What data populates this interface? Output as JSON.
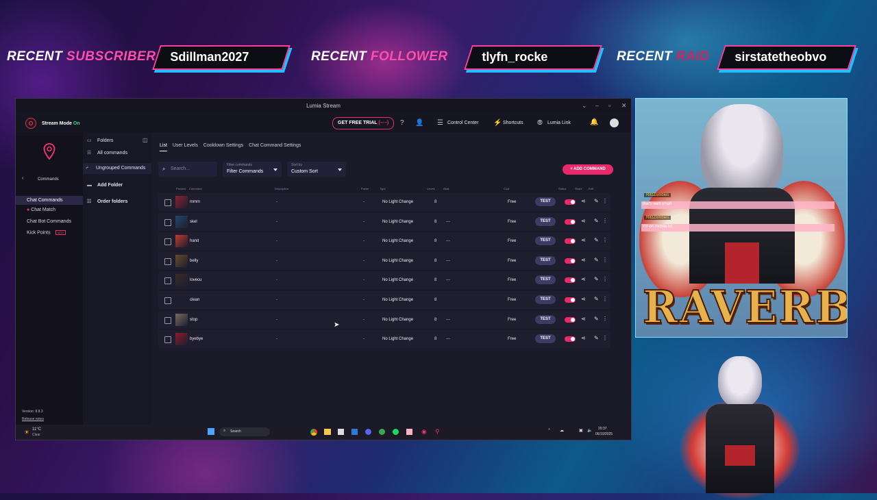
{
  "banners": {
    "subscriber": {
      "label_a": "RECENT ",
      "label_b": "SUBSCRIBER",
      "name": "Sdillman2027"
    },
    "follower": {
      "label_a": "RECENT ",
      "label_b": "FOLLOWER",
      "name": "tlyfn_rocke"
    },
    "raid": {
      "label_a": "RECENT ",
      "label_b": "RAID",
      "name": "sirstatetheobvo"
    }
  },
  "window": {
    "title": "Lumia Stream",
    "stream_mode": "Stream Mode",
    "stream_mode_state": "On",
    "free_trial": "GET FREE TRIAL",
    "control_center": "Control Center",
    "shortcuts": "Shortcuts",
    "lumia_link": "Lumia Link"
  },
  "leftnav": {
    "back_label": "Commands",
    "items": [
      "Chat Commands",
      "Chat Match",
      "Chat Bot Commands",
      "Kick Points"
    ],
    "new_badge": "NEW",
    "version": "Version: 8.8.3",
    "release_notes": "Release notes"
  },
  "folders": {
    "title": "Folders",
    "all": "All commands",
    "ungrouped": "Ungrouped Commands",
    "add": "Add Folder",
    "order": "Order folders"
  },
  "main": {
    "tabs": [
      "List",
      "User Levels",
      "Cooldown Settings",
      "Chat Command Settings"
    ],
    "search_placeholder": "Search...",
    "filter_label": "Filter commands",
    "filter_value": "Filter Commands",
    "sort_label": "Sort by",
    "sort_value": "Custom Sort",
    "add_command": "+ ADD COMMAND",
    "columns": [
      "Preview",
      "Command",
      "Description",
      "Folder",
      "Type",
      "Levels",
      "Alias",
      "Cost",
      "Status",
      "Share",
      "Edit"
    ],
    "test_label": "TEST",
    "rows": [
      {
        "name": "mmm",
        "type": "No Light Change",
        "level": "8",
        "alias": "",
        "cost": "Free",
        "color": "#8a2030"
      },
      {
        "name": "skel",
        "type": "No Light Change",
        "level": "8",
        "alias": "—",
        "cost": "Free",
        "color": "#1e4a6a"
      },
      {
        "name": "hand",
        "type": "No Light Change",
        "level": "8",
        "alias": "—",
        "cost": "Free",
        "color": "#c23b2a"
      },
      {
        "name": "belly",
        "type": "No Light Change",
        "level": "8",
        "alias": "—",
        "cost": "Free",
        "color": "#6a4a2a"
      },
      {
        "name": "lovecu",
        "type": "No Light Change",
        "level": "8",
        "alias": "—",
        "cost": "Free",
        "color": "#3a2a2a"
      },
      {
        "name": "clean",
        "type": "No Light Change",
        "level": "8",
        "alias": "",
        "cost": "Free",
        "color": "#1f1e2e"
      },
      {
        "name": "stop",
        "type": "No Light Change",
        "level": "8",
        "alias": "—",
        "cost": "Free",
        "color": "#7a6a60"
      },
      {
        "name": "byebye",
        "type": "No Light Change",
        "level": "8",
        "alias": "—",
        "cost": "Free",
        "color": "#8a1a2a"
      }
    ]
  },
  "taskbar": {
    "weather_temp": "11°C",
    "weather_desc": "Clear",
    "search": "Search",
    "time": "20:37",
    "date": "06/10/2025"
  },
  "overlay": {
    "chat": [
      {
        "user": "RitzZombies",
        "text": "that's well small"
      },
      {
        "user": "RitzZombies",
        "text": "I'm on mobile lol"
      }
    ],
    "logo": "RAVERBOYZ"
  }
}
